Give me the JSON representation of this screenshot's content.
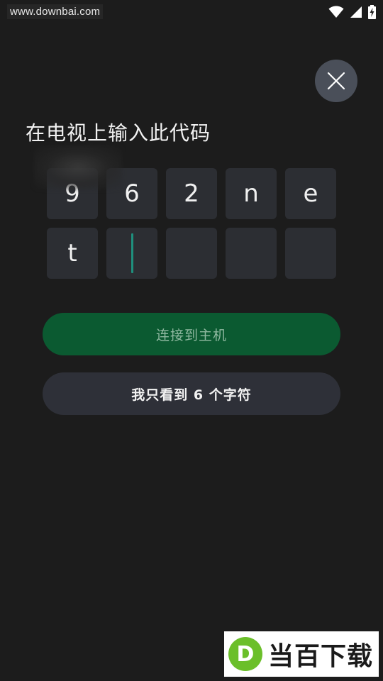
{
  "status_bar": {
    "watermark_url": "www.downbai.com",
    "icons": [
      "wifi-icon",
      "cell-signal-icon",
      "battery-charging-icon"
    ]
  },
  "close_icon": "close-icon",
  "title": "在电视上输入此代码",
  "code": {
    "cells": [
      "9",
      "6",
      "2",
      "n",
      "e",
      "t",
      "",
      "",
      "",
      ""
    ],
    "active_index": 6
  },
  "buttons": {
    "connect_label": "连接到主机",
    "six_chars_label": "我只看到 6 个字符"
  },
  "logo_watermark": {
    "badge_letter": "D",
    "text": "当百下载"
  },
  "colors": {
    "background": "#1c1c1c",
    "primary_button": "#0b5a31",
    "secondary_button": "#2e3038",
    "cell": "#2c2e33",
    "caret": "#1f8f7d"
  }
}
